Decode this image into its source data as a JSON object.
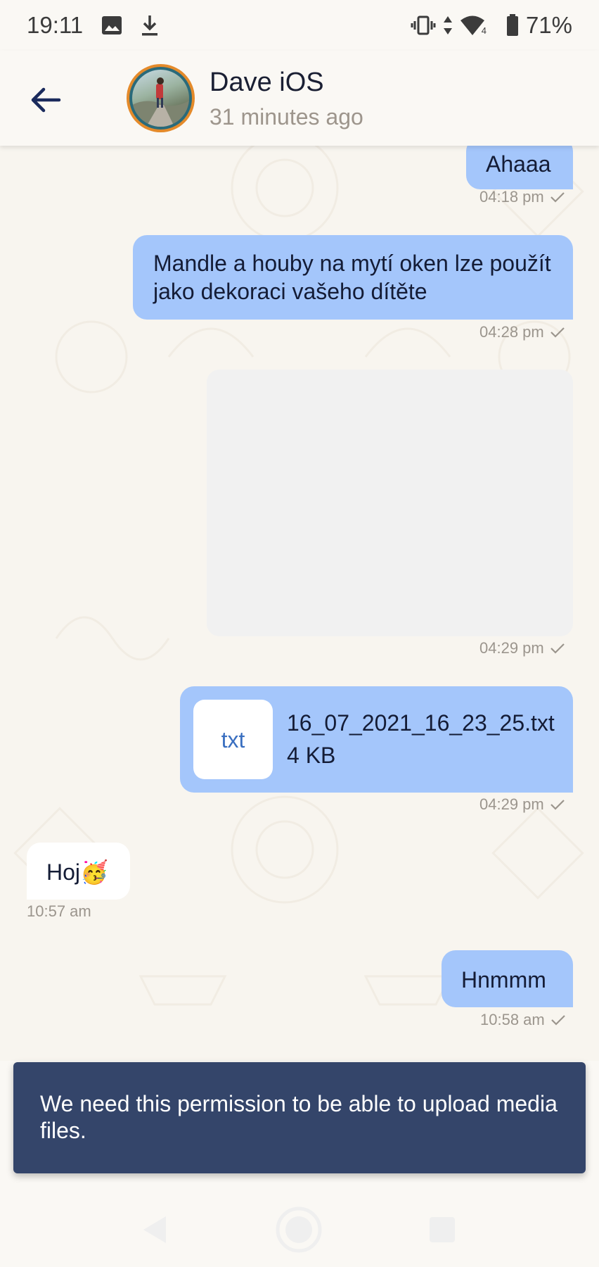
{
  "status_bar": {
    "time": "19:11",
    "battery": "71%",
    "icons": [
      "image-icon",
      "download-icon",
      "vibrate-icon",
      "data-arrows-icon",
      "wifi-icon",
      "signal-icon",
      "battery-icon"
    ],
    "signal_badge": "4"
  },
  "header": {
    "name": "Dave iOS",
    "status": "31 minutes ago"
  },
  "messages": [
    {
      "direction": "out",
      "text": "Ahaaa",
      "time": "04:18 pm"
    },
    {
      "direction": "out",
      "text": "Mandle a houby na mytí oken lze použít jako dekoraci vašeho dítěte",
      "time": "04:28 pm"
    },
    {
      "direction": "out",
      "type": "image",
      "time": "04:29 pm"
    },
    {
      "direction": "out",
      "type": "file",
      "file_ext": "txt",
      "file_name": "16_07_2021_16_23_25.txt",
      "file_size": "4 KB",
      "time": "04:29 pm"
    },
    {
      "direction": "in",
      "text": "Hoj🥳",
      "time": "10:57 am"
    },
    {
      "direction": "out",
      "text": "Hnmmm",
      "time": "10:58 am"
    }
  ],
  "snackbar": {
    "text": "We need this permission to be able to upload media files."
  },
  "colors": {
    "outgoing_bubble": "#a4c6fb",
    "incoming_bubble": "#ffffff",
    "snackbar_bg": "#34456a",
    "background": "#f8f5ef"
  }
}
